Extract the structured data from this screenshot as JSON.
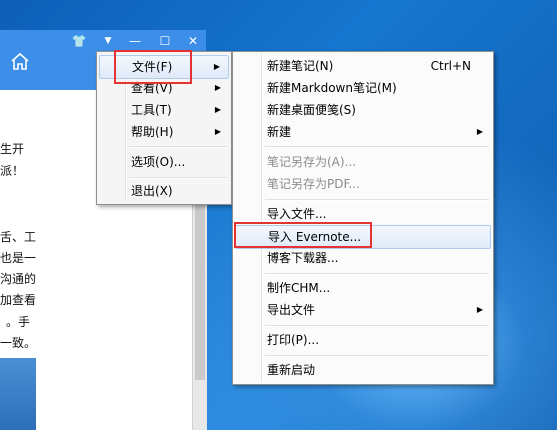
{
  "colors": {
    "titlebar": "#3c8ee8",
    "highlight_box": "#e53333",
    "menu_bg": "#f5f5f5",
    "disabled_text": "#8c8c8c"
  },
  "titlebar": {
    "buttons": [
      {
        "icon": "shirt-icon",
        "glyph": "👕"
      },
      {
        "icon": "dropdown-icon",
        "glyph": "▼"
      },
      {
        "icon": "minimize-icon",
        "glyph": "—"
      },
      {
        "icon": "maximize-icon",
        "glyph": "☐"
      },
      {
        "icon": "close-icon",
        "glyph": "✕"
      }
    ],
    "home_icon": "home-icon"
  },
  "document": {
    "lines": [
      "生开",
      "派！",
      "舌、工",
      "也是一",
      "沟通的",
      "加查看",
      "。手",
      "一致。"
    ]
  },
  "main_menu": {
    "items": [
      {
        "label": "文件(F)",
        "has_submenu": true,
        "selected": true
      },
      {
        "label": "查看(V)",
        "has_submenu": true
      },
      {
        "label": "工具(T)",
        "has_submenu": true
      },
      {
        "label": "帮助(H)",
        "has_submenu": true
      },
      {
        "label": "选项(O)...",
        "has_submenu": false
      },
      {
        "label": "退出(X)",
        "has_submenu": false
      }
    ]
  },
  "file_menu": {
    "items": [
      {
        "label": "新建笔记(N)",
        "shortcut": "Ctrl+N"
      },
      {
        "label": "新建Markdown笔记(M)"
      },
      {
        "label": "新建桌面便笺(S)"
      },
      {
        "label": "新建",
        "has_submenu": true
      },
      {
        "label": "笔记另存为(A)...",
        "disabled": true
      },
      {
        "label": "笔记另存为PDF...",
        "disabled": true
      },
      {
        "label": "导入文件..."
      },
      {
        "label": "导入 Evernote...",
        "selected": true
      },
      {
        "label": "博客下载器..."
      },
      {
        "label": "制作CHM..."
      },
      {
        "label": "导出文件",
        "has_submenu": true
      },
      {
        "label": "打印(P)..."
      },
      {
        "label": "重新启动"
      }
    ]
  }
}
